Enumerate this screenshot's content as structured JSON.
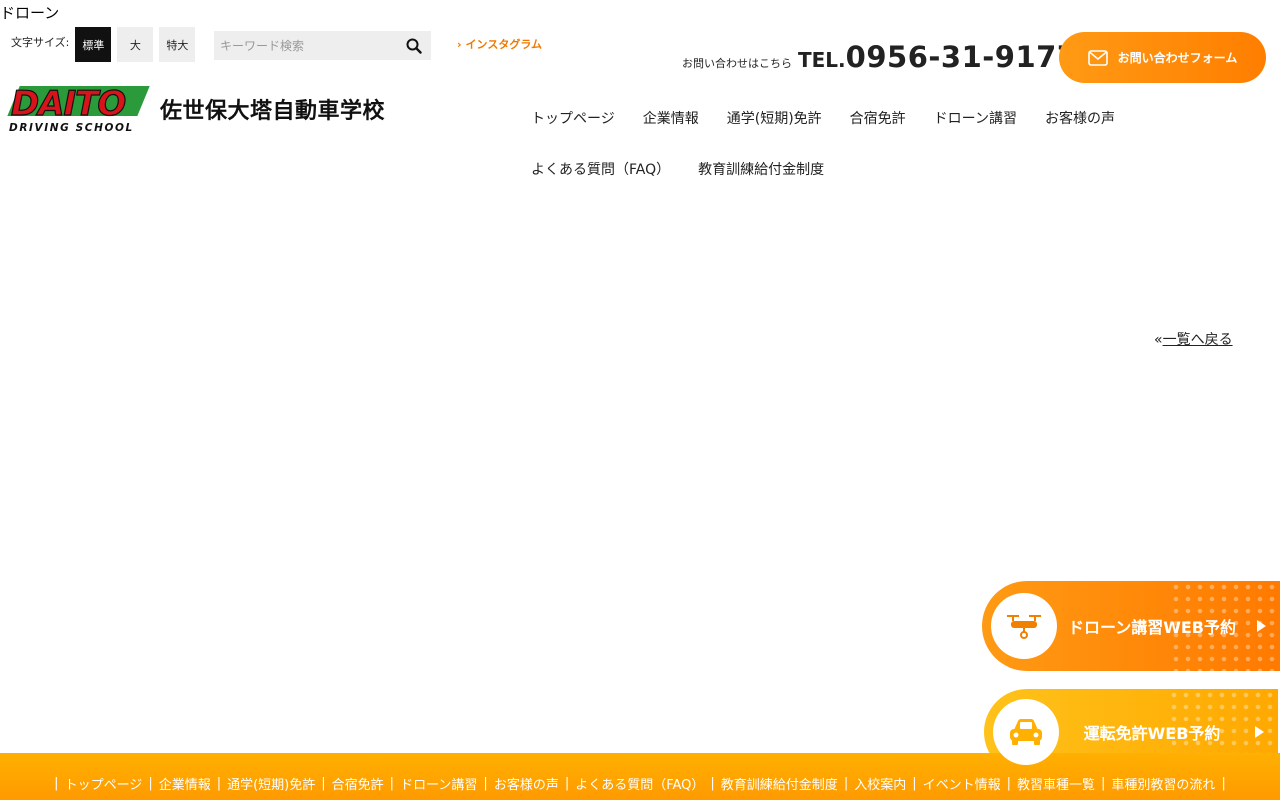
{
  "page_label": "ドローン",
  "font_size": {
    "label": "文字サイズ:",
    "options": [
      "標準",
      "大",
      "特大"
    ],
    "selected": "標準"
  },
  "search": {
    "placeholder": "キーワード検索"
  },
  "instagram": {
    "label": "インスタグラム"
  },
  "contact": {
    "label": "お問い合わせはこちら",
    "tel_prefix": "TEL.",
    "tel_number": "0956-31-9177",
    "form_button": "お問い合わせフォーム"
  },
  "logo": {
    "text": "DAITO",
    "sub": "DRIVING SCHOOL"
  },
  "school_name": "佐世保大塔自動車学校",
  "nav": [
    "トップページ",
    "企業情報",
    "通学(短期)免許",
    "合宿免許",
    "ドローン講習",
    "お客様の声",
    "よくある質問（FAQ）",
    "教育訓練給付金制度"
  ],
  "back_link": {
    "icon": "«",
    "label": "一覧へ戻る"
  },
  "side_buttons": {
    "drone": "ドローン講習WEB予約",
    "license": "運転免許WEB予約"
  },
  "footer": [
    "トップページ",
    "企業情報",
    "通学(短期)免許",
    "合宿免許",
    "ドローン講習",
    "お客様の声",
    "よくある質問（FAQ）",
    "教育訓練給付金制度",
    "入校案内",
    "イベント情報",
    "教習車種一覧",
    "車種別教習の流れ"
  ],
  "colors": {
    "accent_orange": "#ff8c00",
    "footer_orange": "#ffa500",
    "license_yellow": "#ffb400",
    "logo_red": "#d8141b",
    "logo_green": "#2a9a3a"
  }
}
